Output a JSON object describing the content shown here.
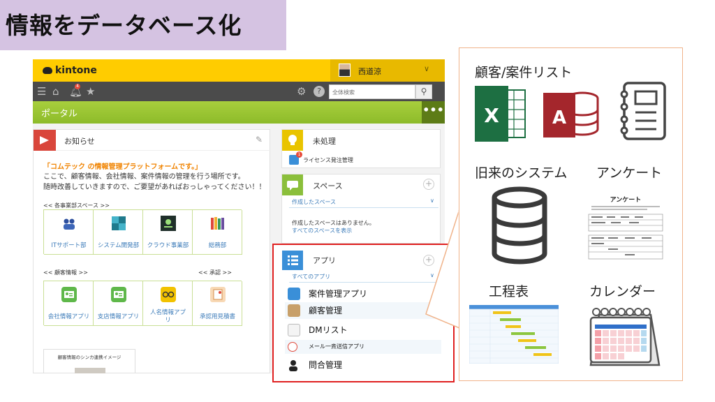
{
  "slide": {
    "title": "情報をデータベース化"
  },
  "kintone": {
    "logo": "kintone",
    "user": {
      "name": "西道涼"
    },
    "nav": {
      "notif_count": "4",
      "search_placeholder": "全体検索"
    },
    "portal": {
      "label": "ポータル",
      "more": "•••"
    },
    "notice": {
      "title": "お知らせ",
      "highlight": "「コムテック の情報管理プラットフォームです。」",
      "lines": [
        "ここで、顧客情報、会社情報、案件情報の管理を行う場所です。",
        "随時改善していきますので、ご要望があればおっしゃってください！！"
      ],
      "dept_label": "<< 各事業部スペース >>",
      "depts": [
        "ITサポート部",
        "システム開発部",
        "クラウド事業部",
        "総務部"
      ],
      "customer_label": "<< 顧客情報 >>",
      "approval_label": "<< 承認 >>",
      "customers": [
        "会社情報アプリ",
        "支店情報アプリ",
        "人名情報アプリ",
        "承認用見積書"
      ],
      "sinka": "顧客情報のシンカ連携イメージ"
    },
    "unprocessed": {
      "title": "未処理",
      "item": "ライセンス発注管理",
      "badge": "1"
    },
    "space": {
      "title": "スペース",
      "created": "作成したスペース",
      "none": "作成したスペースはありません。",
      "show_all": "すべてのスペースを表示"
    },
    "apps": {
      "title": "アプリ",
      "all": "すべてのアプリ",
      "items": [
        "案件管理アプリ",
        "顧客管理",
        "DMリスト",
        "メール一斉送信アプリ",
        "問合管理"
      ]
    }
  },
  "right_panel": {
    "customer_list": "顧客/案件リスト",
    "legacy": "旧来のシステム",
    "survey": "アンケート",
    "process": "工程表",
    "calendar": "カレンダー"
  },
  "colors": {
    "kintone_yellow": "#ffcc00",
    "portal_green": "#9ac534",
    "red_box": "#e02020",
    "panel_border": "#f0b38a"
  }
}
